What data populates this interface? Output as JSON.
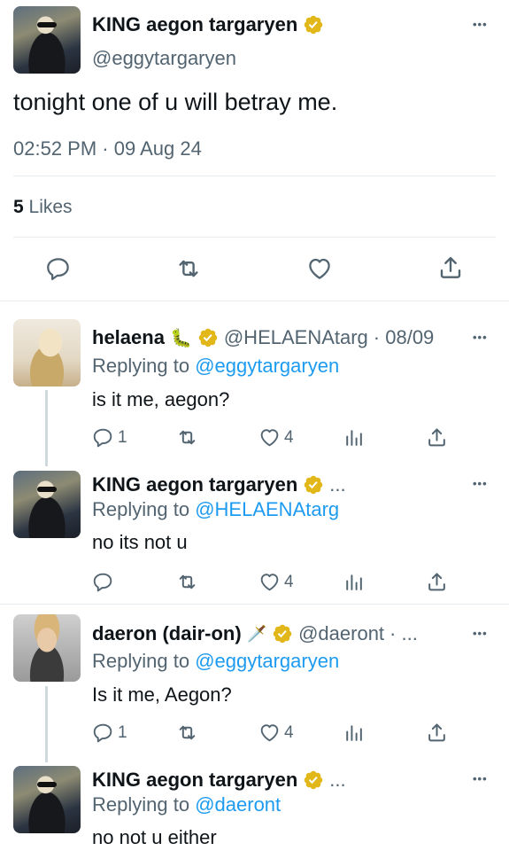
{
  "main_tweet": {
    "name": "KING aegon targaryen",
    "handle": "@eggytargaryen",
    "text": "tonight one of u will betray me.",
    "timestamp": "02:52 PM · 09 Aug 24",
    "likes_count": "5",
    "likes_label": "Likes",
    "more": "•••"
  },
  "replies": [
    {
      "name": "helaena",
      "emoji": "🐛",
      "handle": "@HELAENAtarg",
      "date": "· 08/09",
      "replying_label": "Replying to",
      "replying_to": "@eggytargaryen",
      "text": "is it me, aegon?",
      "reply_count": "1",
      "like_count": "4",
      "more": "•••"
    },
    {
      "name": "KING aegon targaryen",
      "ellipsis": "...",
      "replying_label": "Replying to",
      "replying_to": "@HELAENAtarg",
      "text": "no its not u",
      "like_count": "4",
      "more": "•••"
    },
    {
      "name": "daeron (dair-on)",
      "emoji": "🗡️",
      "handle": "@daeront",
      "date": "· ...",
      "replying_label": "Replying to",
      "replying_to": "@eggytargaryen",
      "text": "Is it me, Aegon?",
      "reply_count": "1",
      "like_count": "4",
      "more": "•••"
    },
    {
      "name": "KING aegon targaryen",
      "ellipsis": "...",
      "replying_label": "Replying to",
      "replying_to": "@daeront",
      "text": "no not u either",
      "more": "•••"
    }
  ],
  "colors": {
    "accent": "#1d9bf0",
    "muted": "#536471",
    "gold_badge": "#e2b719",
    "divider": "#e6ecf0"
  }
}
